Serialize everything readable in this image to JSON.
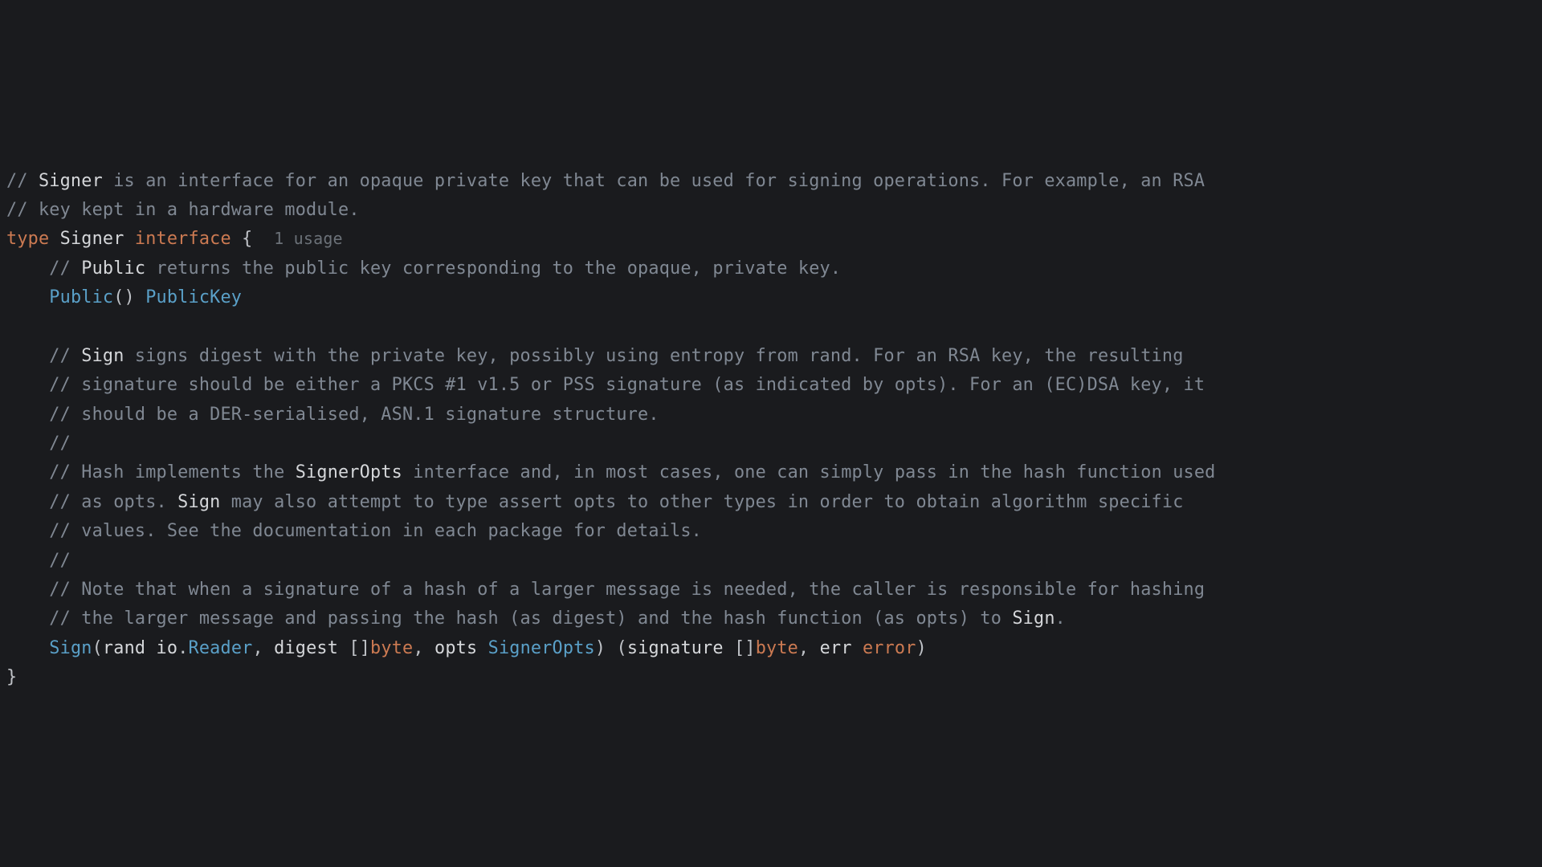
{
  "code": {
    "l1_a": "// ",
    "l1_b": "Signer",
    "l1_c": " is an interface for an opaque private key that can be used for signing operations. For example, an RSA",
    "l2": "// key kept in a hardware module.",
    "l3_kw_type": "type",
    "l3_sp1": " ",
    "l3_name": "Signer",
    "l3_sp2": " ",
    "l3_kw_iface": "interface",
    "l3_brace": " {",
    "l3_usage_sp": "  ",
    "l3_usage": "1 usage",
    "l4_indent": "    ",
    "l4_a": "// ",
    "l4_b": "Public",
    "l4_c": " returns the public key corresponding to the opaque, private key.",
    "l5_indent": "    ",
    "l5_fn": "Public",
    "l5_paren": "()",
    "l5_sp": " ",
    "l5_ret": "PublicKey",
    "l7_indent": "    ",
    "l7_a": "// ",
    "l7_b": "Sign",
    "l7_c": " signs digest with the private key, possibly using entropy from rand. For an RSA key, the resulting",
    "l8_indent": "    ",
    "l8": "// signature should be either a PKCS #1 v1.5 or PSS signature (as indicated by opts). For an (EC)DSA key, it",
    "l9_indent": "    ",
    "l9": "// should be a DER-serialised, ASN.1 signature structure.",
    "l10_indent": "    ",
    "l10": "//",
    "l11_indent": "    ",
    "l11_a": "// Hash implements the ",
    "l11_b": "SignerOpts",
    "l11_c": " interface and, in most cases, one can simply pass in the hash function used",
    "l12_indent": "    ",
    "l12_a": "// as opts. ",
    "l12_b": "Sign",
    "l12_c": " may also attempt to type assert opts to other types in order to obtain algorithm specific",
    "l13_indent": "    ",
    "l13": "// values. See the documentation in each package for details.",
    "l14_indent": "    ",
    "l14": "//",
    "l15_indent": "    ",
    "l15": "// Note that when a signature of a hash of a larger message is needed, the caller is responsible for hashing",
    "l16_indent": "    ",
    "l16_a": "// the larger message and passing the hash (as digest) and the hash function (as opts) to ",
    "l16_b": "Sign",
    "l16_c": ".",
    "l17_indent": "    ",
    "l17_fn": "Sign",
    "l17_p1": "(",
    "l17_arg1": "rand ",
    "l17_io": "io",
    "l17_dot": ".",
    "l17_reader": "Reader",
    "l17_c1": ", ",
    "l17_arg2": "digest ",
    "l17_br1": "[]",
    "l17_byte1": "byte",
    "l17_c2": ", ",
    "l17_arg3": "opts ",
    "l17_so": "SignerOpts",
    "l17_p2": ") (",
    "l17_ret1": "signature ",
    "l17_br2": "[]",
    "l17_byte2": "byte",
    "l17_c3": ", ",
    "l17_ret2": "err ",
    "l17_err": "error",
    "l17_p3": ")",
    "l18": "}"
  }
}
